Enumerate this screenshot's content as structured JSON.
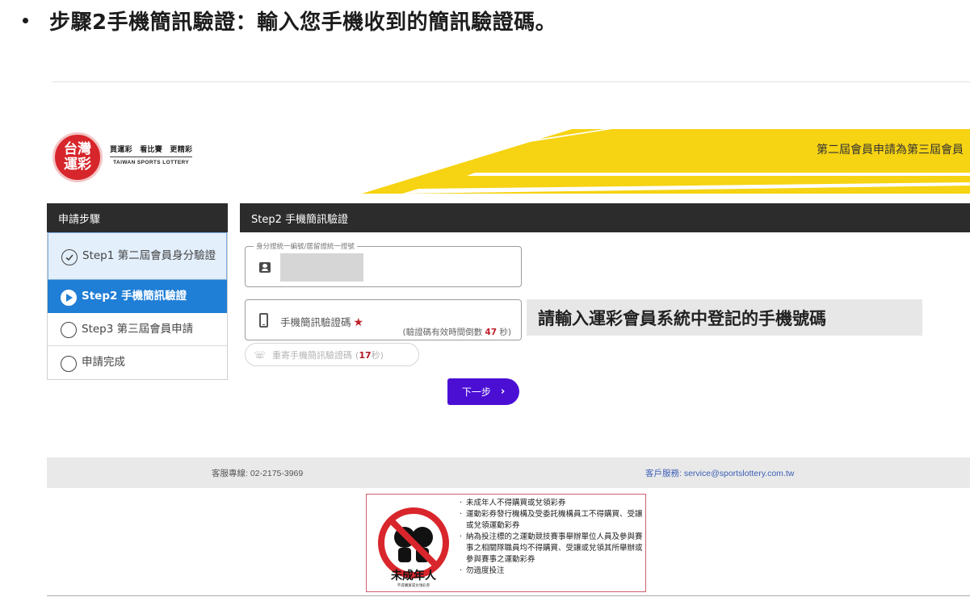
{
  "heading": {
    "text": "步驟2手機簡訊驗證：輸入您手機收到的簡訊驗證碼。"
  },
  "banner": {
    "logo_line1": "台灣",
    "logo_line2": "運彩",
    "slogan": "買運彩　看比賽　更精彩",
    "english_name": "TAIWAN SPORTS LOTTERY",
    "title": "第二屆會員申請為第三屆會員",
    "stripe_color": "#f6d313"
  },
  "sidebar": {
    "header": "申請步驟",
    "steps": [
      {
        "label": "Step1 第二屆會員身分驗證",
        "state": "done"
      },
      {
        "label": "Step2 手機簡訊驗證",
        "state": "active"
      },
      {
        "label": "Step3 第三屆會員申請",
        "state": "pending"
      },
      {
        "label": "申請完成",
        "state": "pending"
      }
    ]
  },
  "main": {
    "header": "Step2 手機簡訊驗證",
    "id_field": {
      "legend": "身分證統一編號/居留證統一證號",
      "value_masked": true
    },
    "sms_field": {
      "label": "手機簡訊驗證碼",
      "required_mark": "★",
      "hint_prefix": "(驗證碼有效時間倒數",
      "hint_seconds": "47",
      "hint_suffix": "秒)"
    },
    "callout": "請輸入運彩會員系統中登記的手機號碼",
    "resend": {
      "label": "重寄手機簡訊驗證碼",
      "open": "(",
      "seconds": "17",
      "suffix": "秒)"
    },
    "next_button": {
      "label": "下一步",
      "chevron": "›",
      "color": "#4b0fd4"
    }
  },
  "footer": {
    "hotline": "客服專線: 02-2175-3969",
    "email": "客戶服務: service@sportslottery.com.tw"
  },
  "warning": {
    "caption": "未成年人",
    "caption_sub": "不得購買或兌領彩券",
    "items": [
      "未成年人不得購買或兌領彩券",
      "運動彩券發行機構及受委託機構員工不得購買、受讓或兌領運動彩券",
      "納為投注標的之運動競技賽事舉辦單位人員及參與賽事之相關隊職員均不得購買、受讓或兌領其所舉辦或參與賽事之運動彩券",
      "勿過度投注"
    ]
  }
}
